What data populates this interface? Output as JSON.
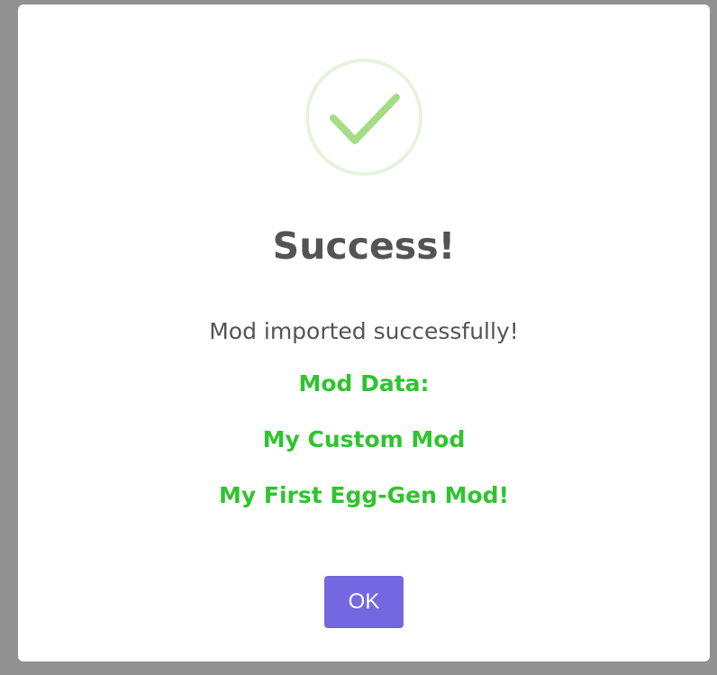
{
  "dialog": {
    "icon": "success-check-icon",
    "title": "Success!",
    "message": "Mod imported successfully!",
    "mod_data_label": "Mod Data:",
    "mod_name": "My Custom Mod",
    "mod_description": "My First Egg-Gen Mod!",
    "ok_label": "OK"
  },
  "colors": {
    "overlay": "#919191",
    "dialog_background": "#ffffff",
    "title_text": "#545454",
    "accent_green": "#2fc42f",
    "check_stroke": "#a5dc86",
    "check_ring": "#e6f4dc",
    "button": "#7467e0"
  }
}
